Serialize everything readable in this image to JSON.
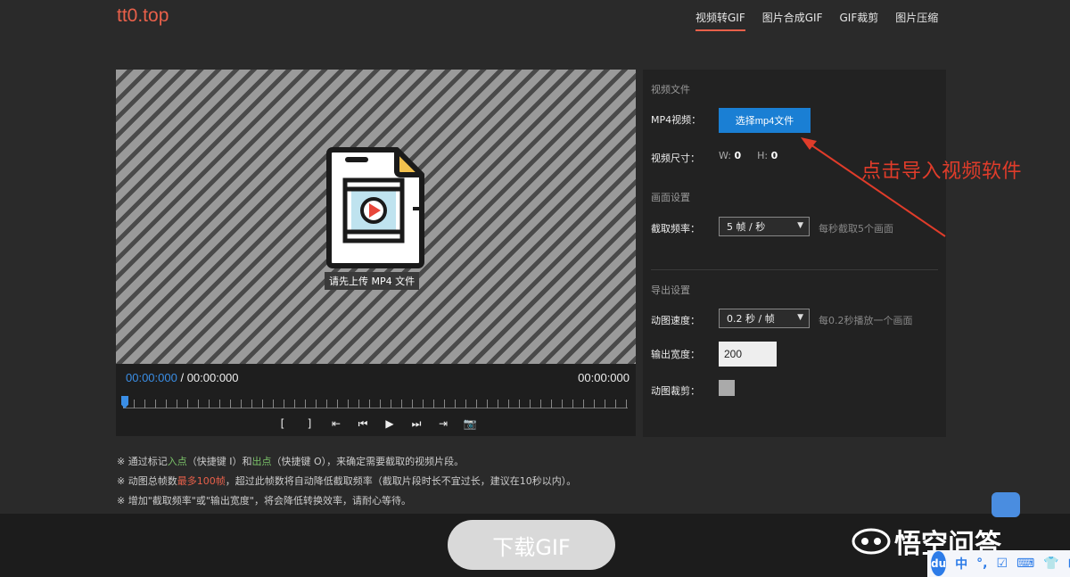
{
  "header": {
    "logo": "tt0.top",
    "nav": [
      {
        "label": "视频转GIF"
      },
      {
        "label": "图片合成GIF"
      },
      {
        "label": "GIF裁剪"
      },
      {
        "label": "图片压缩"
      }
    ]
  },
  "player": {
    "upload_hint": "请先上传 MP4 文件",
    "time_current": "00:00:000",
    "time_sep": " / ",
    "time_total": "00:00:000",
    "time_right": "00:00:000",
    "controls": [
      "[",
      "]",
      "⇤",
      "⏮",
      "▶",
      "⏭",
      "⇥",
      "📷"
    ]
  },
  "panel": {
    "video_section": "视频文件",
    "mp4_label": "MP4视频：",
    "choose_button": "选择mp4文件",
    "size_label": "视频尺寸：",
    "w_label": "W:",
    "w_value": "0",
    "h_label": "H:",
    "h_value": "0",
    "frame_section": "画面设置",
    "rate_label": "截取频率：",
    "rate_value": "5 帧 / 秒",
    "rate_hint": "每秒截取5个画面",
    "export_section": "导出设置",
    "speed_label": "动图速度：",
    "speed_value": "0.2 秒 / 帧",
    "speed_hint": "每0.2秒播放一个画面",
    "width_label": "输出宽度：",
    "width_value": "200",
    "crop_label": "动图裁剪："
  },
  "annotation": "点击导入视频软件",
  "notes": {
    "n1_a": "※ 通过标记",
    "n1_in": "入点",
    "n1_b": "（快捷键 I）和",
    "n1_out": "出点",
    "n1_c": "（快捷键 O），来确定需要截取的视频片段。",
    "n2_a": "※ 动图总帧数",
    "n2_max": "最多100帧",
    "n2_b": "，超过此帧数将自动降低截取频率（截取片段时长不宜过长，建议在10秒以内）。",
    "n3": "※ 增加\"截取频率\"或\"输出宽度\"，将会降低转换效率，请耐心等待。"
  },
  "download_label": "下载GIF",
  "watermark": "悟空问答",
  "ime": {
    "logo": "du",
    "items": [
      "中",
      "°,",
      "☑",
      "⌨",
      "👕",
      "⊞"
    ]
  },
  "colors": {
    "accent": "#e8604a",
    "primary_button": "#1a7fd4",
    "time_blue": "#3a8ee6",
    "annotation": "#e03c2a"
  }
}
